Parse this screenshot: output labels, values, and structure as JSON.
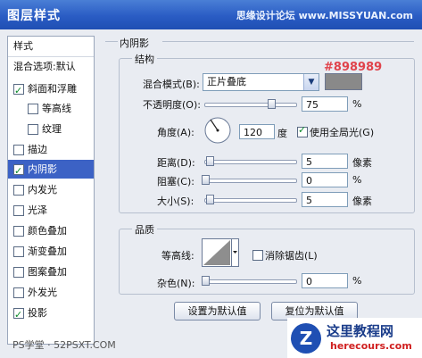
{
  "window": {
    "title": "图层样式",
    "watermark": "思缘设计论坛 www.MISSYUAN.com"
  },
  "left_panel": {
    "header": "样式",
    "subheader": "混合选项:默认",
    "items": [
      {
        "label": "斜面和浮雕",
        "checked": true
      },
      {
        "label": "等高线",
        "checked": false
      },
      {
        "label": "纹理",
        "checked": false
      },
      {
        "label": "描边",
        "checked": false
      },
      {
        "label": "内阴影",
        "checked": true
      },
      {
        "label": "内发光",
        "checked": false
      },
      {
        "label": "光泽",
        "checked": false
      },
      {
        "label": "颜色叠加",
        "checked": false
      },
      {
        "label": "渐变叠加",
        "checked": false
      },
      {
        "label": "图案叠加",
        "checked": false
      },
      {
        "label": "外发光",
        "checked": false
      },
      {
        "label": "投影",
        "checked": true
      }
    ]
  },
  "section_title": "内阴影",
  "structure": {
    "title": "结构",
    "blend_label": "混合模式(B):",
    "blend_value": "正片叠底",
    "color_label": "#898989",
    "color_hex": "#898989",
    "opacity_label": "不透明度(O):",
    "opacity_value": "75",
    "opacity_unit": "%",
    "opacity_fraction": 0.75,
    "angle_label": "角度(A):",
    "angle_value": "120",
    "angle_unit": "度",
    "global_light_label": "使用全局光(G)",
    "global_light_checked": true,
    "distance_label": "距离(D):",
    "distance_value": "5",
    "distance_unit": "像素",
    "choke_label": "阻塞(C):",
    "choke_value": "0",
    "choke_unit": "%",
    "size_label": "大小(S):",
    "size_value": "5",
    "size_unit": "像素"
  },
  "quality": {
    "title": "品质",
    "contour_label": "等高线:",
    "antialias_label": "消除锯齿(L)",
    "antialias_checked": false,
    "noise_label": "杂色(N):",
    "noise_value": "0",
    "noise_unit": "%"
  },
  "buttons": {
    "make_default": "设置为默认值",
    "reset_default": "复位为默认值"
  },
  "branding": {
    "bottom_left": "PS学堂 · 52PSXT.COM",
    "site_name": "这里教程网",
    "site_url": "herecours.com"
  }
}
